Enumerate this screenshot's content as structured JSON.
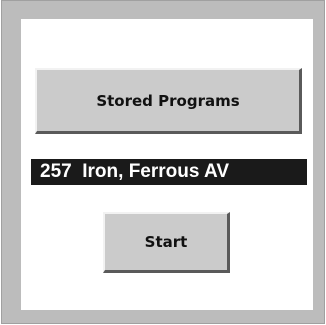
{
  "buttons": {
    "stored_programs_label": "Stored Programs",
    "start_label": "Start"
  },
  "program": {
    "display": "257  Iron, Ferrous AV"
  },
  "colors": {
    "frame": "#bcbcbc",
    "panel": "#ffffff",
    "button_face": "#cbcbcb",
    "program_bar": "#1a1a1a",
    "program_text": "#ffffff"
  }
}
